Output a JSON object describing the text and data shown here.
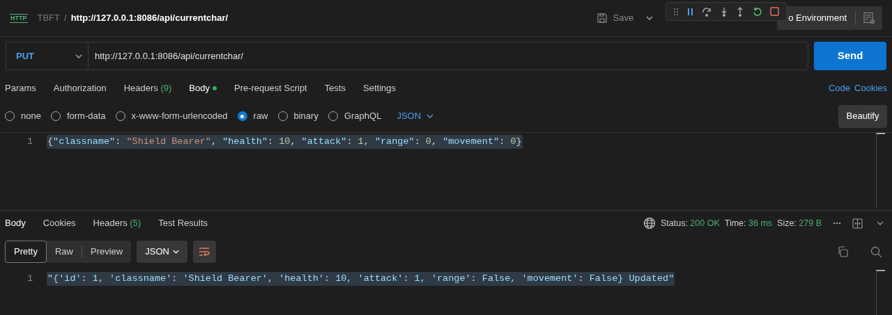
{
  "header": {
    "badge": "HTTP",
    "collection": "TBFT",
    "separator": "/",
    "title": "http://127.0.0.1:8086/api/currentchar/",
    "save": "Save",
    "environment": "o Environment"
  },
  "debug_toolbar": {
    "buttons": [
      {
        "kind": "grip"
      },
      {
        "kind": "pause"
      },
      {
        "kind": "step-over"
      },
      {
        "kind": "step-into"
      },
      {
        "kind": "step-out"
      },
      {
        "kind": "restart"
      },
      {
        "kind": "stop"
      }
    ]
  },
  "request": {
    "method": "PUT",
    "url": "http://127.0.0.1:8086/api/currentchar/",
    "send": "Send"
  },
  "request_tabs": [
    {
      "label": "Params",
      "selected": false
    },
    {
      "label": "Authorization",
      "selected": false
    },
    {
      "label": "Headers",
      "count": "(9)",
      "selected": false
    },
    {
      "label": "Body",
      "dot": true,
      "selected": true
    },
    {
      "label": "Pre-request Script",
      "selected": false
    },
    {
      "label": "Tests",
      "selected": false
    },
    {
      "label": "Settings",
      "selected": false
    }
  ],
  "request_links": [
    "Code",
    "Cookies"
  ],
  "body_types": [
    {
      "label": "none",
      "selected": false
    },
    {
      "label": "form-data",
      "selected": false
    },
    {
      "label": "x-www-form-urlencoded",
      "selected": false
    },
    {
      "label": "raw",
      "selected": true
    },
    {
      "label": "binary",
      "selected": false
    },
    {
      "label": "GraphQL",
      "selected": false
    }
  ],
  "language": "JSON",
  "beautify": "Beautify",
  "request_body": [
    {
      "number": "1",
      "code": "{\"classname\": \"Shield Bearer\", \"health\": 10, \"attack\": 1, \"range\": 0, \"movement\": 0}"
    }
  ],
  "response_tabs": [
    {
      "label": "Body",
      "selected": true
    },
    {
      "label": "Cookies",
      "selected": false
    },
    {
      "label": "Headers",
      "count": "(5)",
      "selected": false
    },
    {
      "label": "Test Results",
      "selected": false
    }
  ],
  "response_meta": [
    {
      "label": "Status:",
      "value": "200 OK"
    },
    {
      "label": "Time:",
      "value": "36 ms"
    },
    {
      "label": "Size:",
      "value": "279 B"
    }
  ],
  "view_modes": [
    {
      "label": "Pretty",
      "selected": true
    },
    {
      "label": "Raw",
      "selected": false
    },
    {
      "label": "Preview",
      "selected": false
    }
  ],
  "response_format": "JSON",
  "response_body": [
    {
      "number": "1",
      "code": "\"{'id': 1, 'classname': 'Shield Bearer', 'health': 10, 'attack': 1, 'range': False, 'movement': False} Updated\""
    }
  ]
}
